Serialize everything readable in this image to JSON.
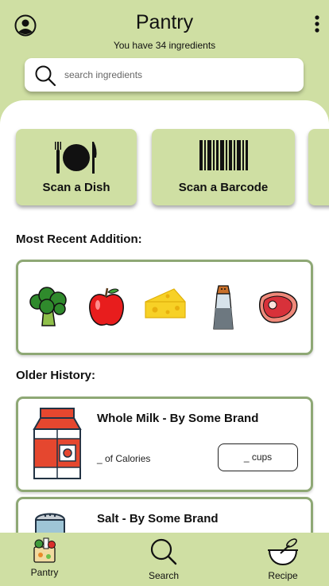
{
  "header": {
    "title": "Pantry",
    "subtitle": "You have 34 ingredients"
  },
  "search": {
    "placeholder": "search ingredients"
  },
  "actions": [
    {
      "label": "Scan a Dish",
      "icon": "plate-utensils-icon"
    },
    {
      "label": "Scan a Barcode",
      "icon": "barcode-icon"
    }
  ],
  "recent": {
    "title": "Most Recent Addition:",
    "items": [
      "broccoli-icon",
      "apple-icon",
      "cheese-icon",
      "salt-shaker-icon",
      "steak-icon"
    ]
  },
  "history": {
    "title": "Older History:",
    "items": [
      {
        "name": "Whole Milk - By Some Brand",
        "calories": "_ of Calories",
        "quantity": "_ cups",
        "icon": "milk-carton-icon"
      },
      {
        "name": "Salt - By Some Brand",
        "icon": "salt-shaker-icon"
      }
    ]
  },
  "nav": {
    "pantry": "Pantry",
    "search": "Search",
    "recipe": "Recipe"
  },
  "colors": {
    "accent": "#cfdfa3",
    "card_border": "#8ea875",
    "panel": "#ffffff"
  }
}
